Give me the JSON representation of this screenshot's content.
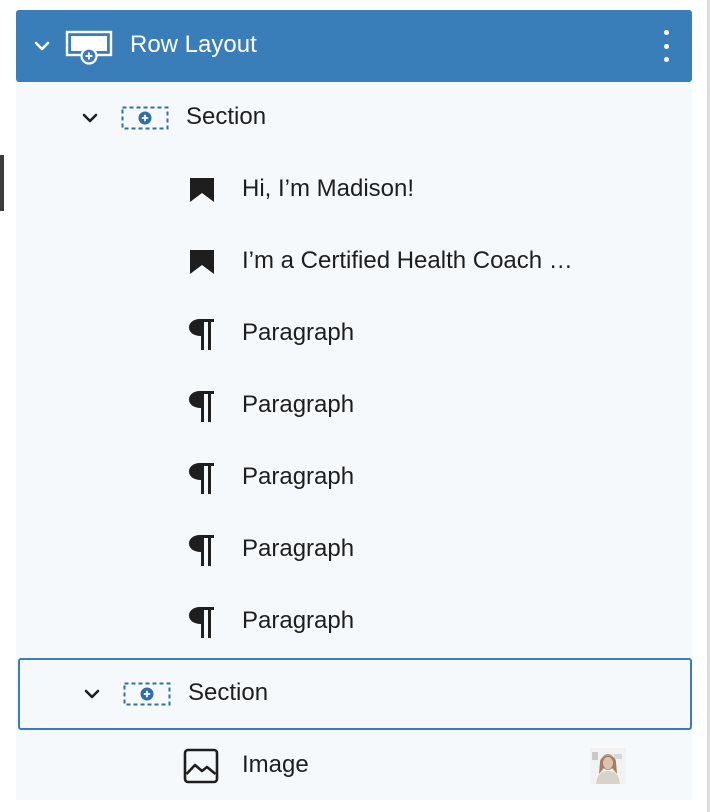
{
  "list_view": {
    "items": [
      {
        "label": "Row Layout",
        "icon": "row-layout-icon",
        "expanded": true,
        "selected": true
      },
      {
        "label": "Section",
        "icon": "section-icon",
        "expanded": true
      },
      {
        "label": "Hi, I’m Madison!",
        "icon": "bookmark-icon"
      },
      {
        "label": "I’m a Certified Health Coach …",
        "icon": "bookmark-icon"
      },
      {
        "label": "Paragraph",
        "icon": "paragraph-icon"
      },
      {
        "label": "Paragraph",
        "icon": "paragraph-icon"
      },
      {
        "label": "Paragraph",
        "icon": "paragraph-icon"
      },
      {
        "label": "Paragraph",
        "icon": "paragraph-icon"
      },
      {
        "label": "Paragraph",
        "icon": "paragraph-icon"
      },
      {
        "label": "Section",
        "icon": "section-icon",
        "expanded": true,
        "focused": true
      },
      {
        "label": "Image",
        "icon": "image-icon"
      }
    ]
  },
  "colors": {
    "accent": "#3a7eb9",
    "panel_bg": "#f5f9fc",
    "text": "#1e1e1e"
  }
}
